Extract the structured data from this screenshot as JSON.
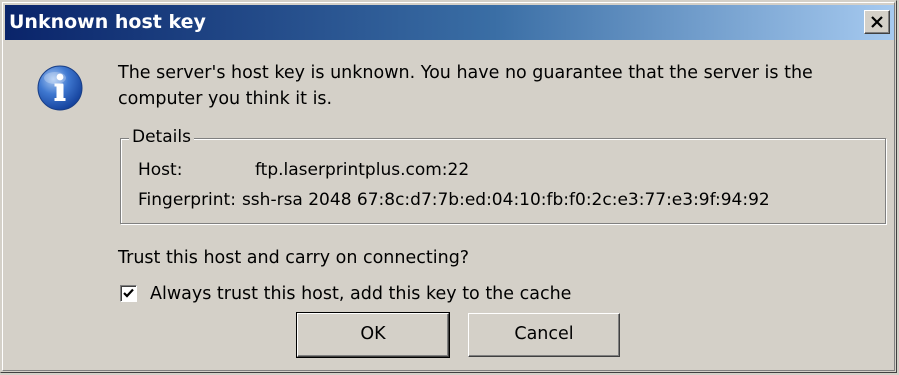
{
  "window": {
    "title": "Unknown host key"
  },
  "message": {
    "text": "The server's host key is unknown. You have no guarantee that the server is the computer you think it is."
  },
  "details": {
    "legend": "Details",
    "host_label": "Host:",
    "host_value": "ftp.laserprintplus.com:22",
    "fingerprint_label": "Fingerprint:",
    "fingerprint_value": "ssh-rsa 2048 67:8c:d7:7b:ed:04:10:fb:f0:2c:e3:77:e3:9f:94:92"
  },
  "question": "Trust this host and carry on connecting?",
  "checkbox": {
    "label": "Always trust this host, add this key to the cache",
    "checked": true
  },
  "buttons": {
    "ok": "OK",
    "cancel": "Cancel"
  },
  "icons": {
    "title_close": "close-icon",
    "info": "info-icon",
    "checkmark": "checkmark-icon"
  },
  "colors": {
    "titlebar_start": "#0a246a",
    "titlebar_end": "#a6caf0",
    "dialog_bg": "#d4d0c8"
  }
}
